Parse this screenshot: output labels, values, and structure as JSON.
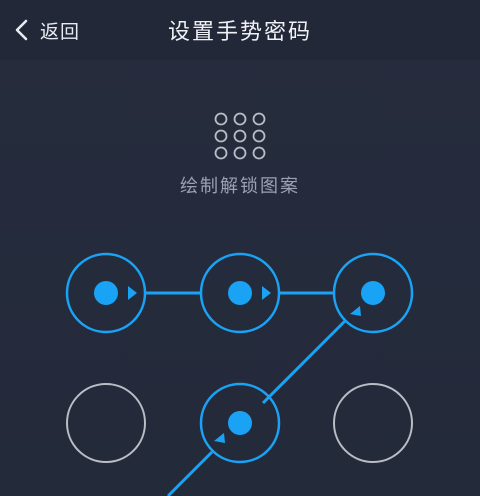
{
  "header": {
    "back_label": "返回",
    "title": "设置手势密码"
  },
  "hint": "绘制解锁图案",
  "icons": {
    "back": "chevron-left-icon",
    "preview": "pattern-grid-icon"
  },
  "pattern": {
    "selected_sequence": [
      1,
      2,
      3,
      5
    ],
    "nodes": [
      {
        "id": 1,
        "selected": true
      },
      {
        "id": 2,
        "selected": true
      },
      {
        "id": 3,
        "selected": true
      },
      {
        "id": 4,
        "selected": false
      },
      {
        "id": 5,
        "selected": true
      },
      {
        "id": 6,
        "selected": false
      }
    ]
  },
  "colors": {
    "background": "#242a3b",
    "accent": "#1aa3f5",
    "inactive_ring": "#b9bdc6",
    "title_text": "#f0f2f7",
    "hint_text": "#9aa1b0"
  }
}
